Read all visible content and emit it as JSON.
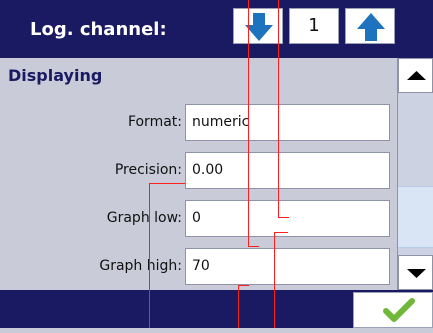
{
  "header": {
    "title": "Log. channel:",
    "down_icon": "arrow-down-icon",
    "up_icon": "arrow-up-icon",
    "counter_value": "1"
  },
  "section": {
    "title": "Displaying"
  },
  "fields": [
    {
      "label": "Format:",
      "value": "numeric"
    },
    {
      "label": "Precision:",
      "value": "0.00"
    },
    {
      "label": "Graph low:",
      "value": "0"
    },
    {
      "label": "Graph high:",
      "value": "70"
    }
  ],
  "scrollbar": {
    "up_icon": "triangle-up-icon",
    "down_icon": "triangle-down-icon"
  },
  "footer": {
    "ok_icon": "checkmark-icon"
  },
  "colors": {
    "header_background": "#1a1a63",
    "page_background": "#c9cbd8",
    "accent_blue": "#1e73be",
    "ok_green": "#71b73a",
    "annotation_red": "#ff1f1f"
  }
}
